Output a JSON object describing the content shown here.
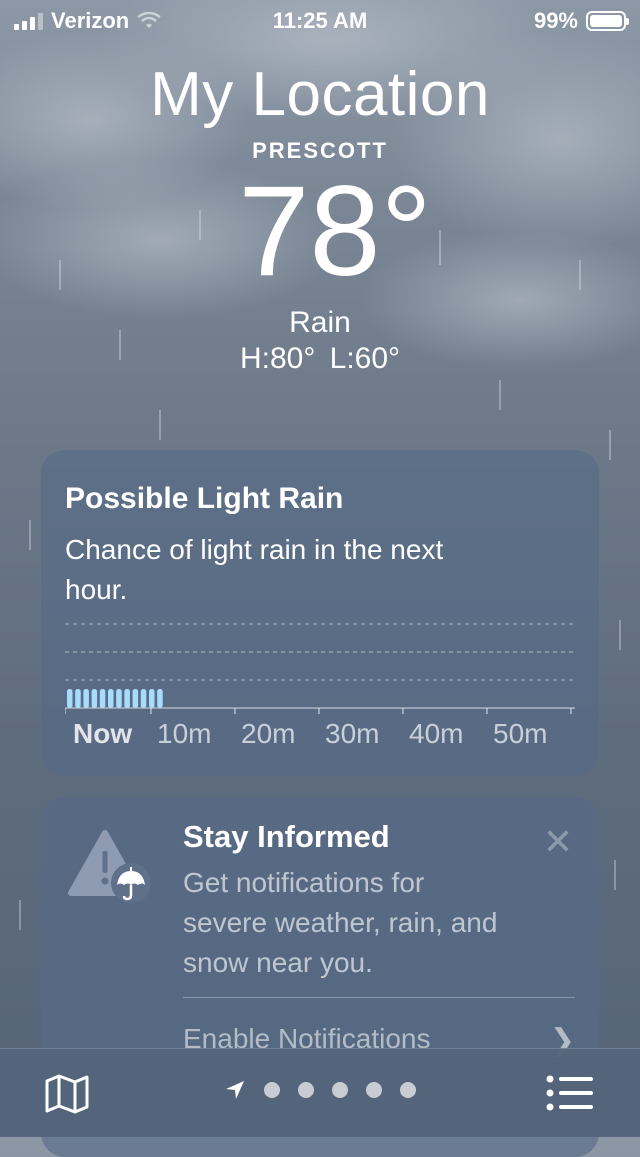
{
  "status_bar": {
    "carrier": "Verizon",
    "time": "11:25 AM",
    "battery": "99%"
  },
  "hero": {
    "location_title": "My Location",
    "city": "PRESCOTT",
    "temperature": "78°",
    "condition": "Rain",
    "high_low": "H:80° L:60°"
  },
  "precip_card": {
    "title": "Possible Light Rain",
    "description": "Chance of light rain in the next hour.",
    "time_labels": [
      "Now",
      "10m",
      "20m",
      "30m",
      "40m",
      "50m"
    ],
    "bar_count": 12
  },
  "notify_card": {
    "title": "Stay Informed",
    "description": "Get notifications for severe weather, rain, and snow near you.",
    "action": "Enable Notifications",
    "close_icon": "close-icon",
    "warning_icon": "warning-umbrella-icon"
  },
  "bottom_bar": {
    "map_icon": "map-icon",
    "location_icon": "location-arrow-icon",
    "page_count": 5,
    "list_icon": "list-icon"
  },
  "colors": {
    "rain_bar": "#a8dcff",
    "card_bg": "#566b87"
  }
}
